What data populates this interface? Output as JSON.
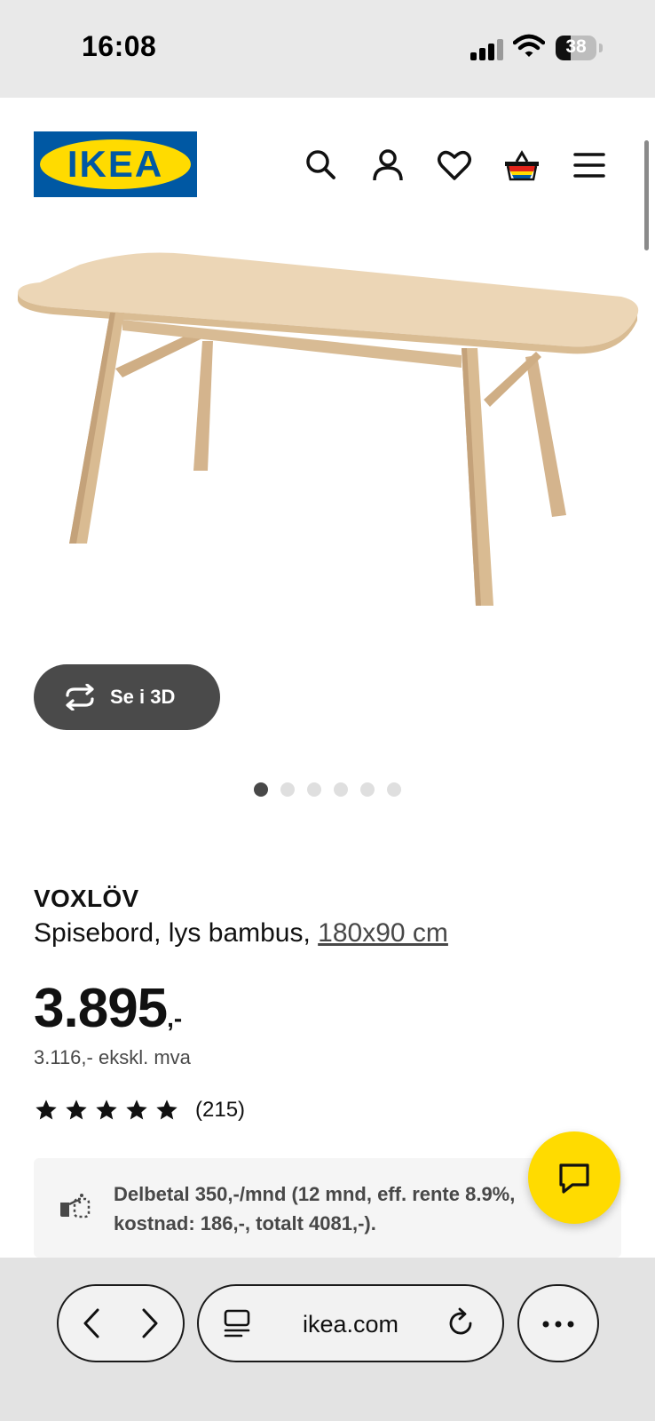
{
  "status_bar": {
    "time": "16:08",
    "battery": "38",
    "battery_level": 0.38,
    "icons": [
      "signal-icon",
      "wifi-icon",
      "battery-icon"
    ]
  },
  "header": {
    "logo_text": "IKEA",
    "icons": [
      "search-icon",
      "account-icon",
      "heart-icon",
      "cart-icon",
      "menu-icon"
    ]
  },
  "colors": {
    "ikea_blue": "#0058a3",
    "ikea_yellow": "#ffdb00",
    "button_dark": "#4a4a4a",
    "text_secondary": "#484848"
  },
  "gallery": {
    "view_3d_label": "Se i 3D",
    "image_count": 6,
    "active_index": 0
  },
  "product": {
    "name": "VOXLÖV",
    "description": "Spisebord, lys bambus,",
    "size_link": "180x90 cm",
    "price_integer": "3.895",
    "price_suffix": ",-",
    "price_ex_vat": "3.116,- ekskl. mva",
    "rating_stars": 5,
    "rating_count": "(215)"
  },
  "installment": {
    "text": "Delbetal 350,-/mnd (12 mnd, eff. rente 8.9%, kostnad: 186,-, totalt 4081,-)."
  },
  "browser": {
    "url": "ikea.com"
  }
}
